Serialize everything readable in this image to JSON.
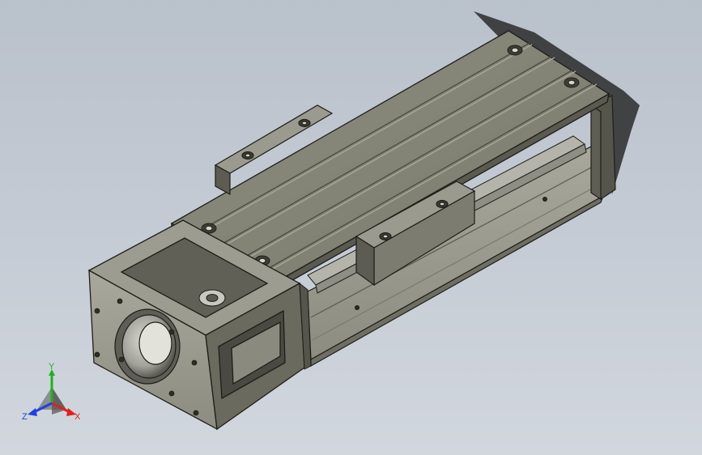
{
  "triad": {
    "x_label": "X",
    "y_label": "Y",
    "z_label": "Z",
    "x_color": "#e02020",
    "y_color": "#20b020",
    "z_color": "#2040e0"
  },
  "model": {
    "body_color": "#6e6e62",
    "face_light": "#8a8a7c",
    "face_dark": "#4a4a42",
    "edge_color": "#1e1e1a"
  }
}
